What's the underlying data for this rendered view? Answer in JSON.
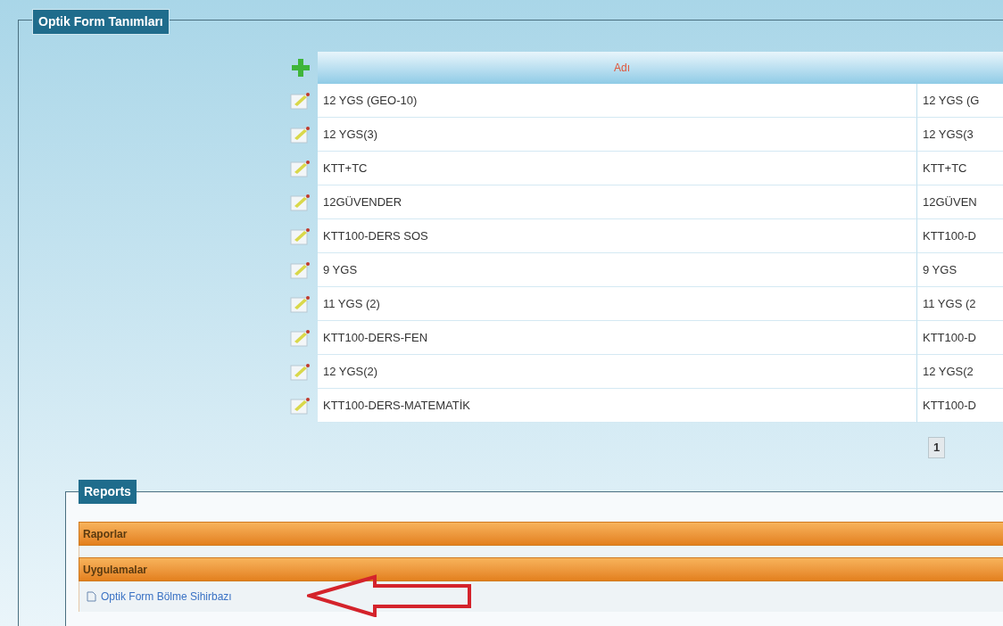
{
  "panel": {
    "title": "Optik Form Tanımları"
  },
  "table": {
    "columns": [
      "Adı"
    ],
    "rows": [
      {
        "name": "12 YGS (GEO-10)",
        "column_2": "12 YGS (G"
      },
      {
        "name": "12 YGS(3)",
        "column_2": "12 YGS(3"
      },
      {
        "name": "KTT+TC",
        "column_2": "KTT+TC"
      },
      {
        "name": "12GÜVENDER",
        "column_2": "12GÜVEN"
      },
      {
        "name": "KTT100-DERS SOS",
        "column_2": "KTT100-D"
      },
      {
        "name": "9 YGS",
        "column_2": "9 YGS"
      },
      {
        "name": "11 YGS (2)",
        "column_2": "11 YGS (2"
      },
      {
        "name": "KTT100-DERS-FEN",
        "column_2": "KTT100-D"
      },
      {
        "name": "12 YGS(2)",
        "column_2": "12 YGS(2"
      },
      {
        "name": "KTT100-DERS-MATEMATİK",
        "column_2": "KTT100-D"
      }
    ]
  },
  "pagination": [
    {
      "label": "1",
      "selected": true
    }
  ],
  "reports": {
    "title": "Reports",
    "sections": [
      {
        "title": "Raporlar"
      },
      {
        "title": "Uygulamalar",
        "links": [
          "Optik Form Bölme Sihirbazı"
        ]
      }
    ]
  }
}
